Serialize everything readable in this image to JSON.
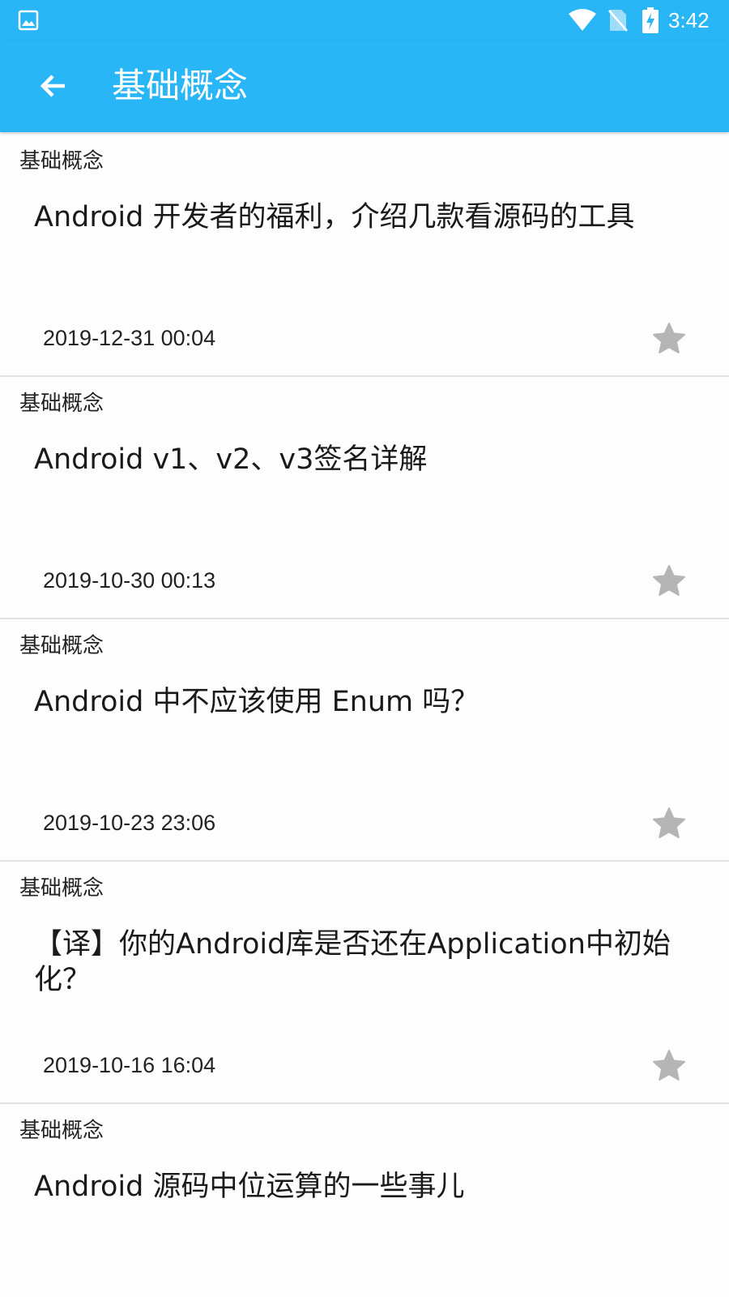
{
  "status_bar": {
    "time": "3:42",
    "icons": [
      "gallery-icon",
      "wifi-icon",
      "no-sim-icon",
      "battery-charging-icon"
    ]
  },
  "app_bar": {
    "title": "基础概念",
    "back_icon": "arrow-left-icon"
  },
  "colors": {
    "primary": "#29b6f6",
    "star": "#b5b5b5",
    "divider": "#e2e2e2"
  },
  "articles": [
    {
      "category": "基础概念",
      "title": "Android 开发者的福利，介绍几款看源码的工具",
      "date": "2019-12-31 00:04",
      "icon": "star-icon"
    },
    {
      "category": "基础概念",
      "title": "Android v1、v2、v3签名详解",
      "date": "2019-10-30 00:13",
      "icon": "star-icon"
    },
    {
      "category": "基础概念",
      "title": "Android 中不应该使用 Enum 吗？",
      "date": "2019-10-23 23:06",
      "icon": "star-icon"
    },
    {
      "category": "基础概念",
      "title": "【译】你的Android库是否还在Application中初始化？",
      "date": "2019-10-16 16:04",
      "icon": "star-icon"
    },
    {
      "category": "基础概念",
      "title": "Android 源码中位运算的一些事儿",
      "date": "",
      "icon": "star-icon"
    }
  ]
}
